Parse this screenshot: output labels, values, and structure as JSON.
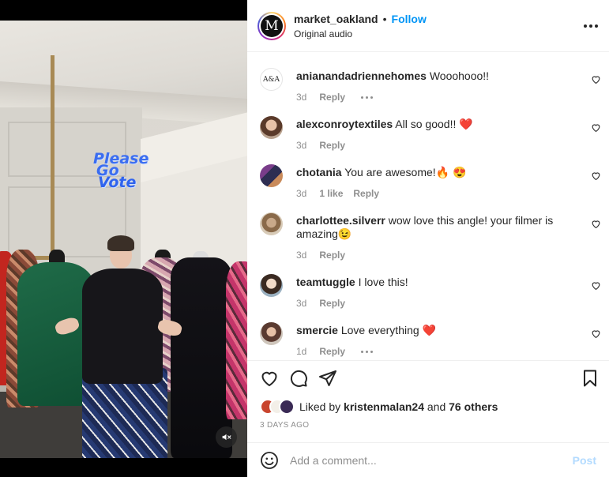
{
  "post": {
    "username": "market_oakland",
    "separator": "•",
    "follow_label": "Follow",
    "audio": "Original audio",
    "avatar_letter": "M",
    "more_icon": "more-horizontal-icon"
  },
  "media": {
    "sticker_lines": [
      "Please",
      "Go",
      "Vote"
    ],
    "mute_icon": "speaker-muted-icon"
  },
  "comments": [
    {
      "username": "anianandadriennehomes",
      "text": "Wooohooo!!",
      "time": "3d",
      "likes": "",
      "reply": "Reply",
      "has_more": true,
      "avatar_text": "A&A"
    },
    {
      "username": "alexconroytextiles",
      "text": "All so good!! ❤️",
      "time": "3d",
      "likes": "",
      "reply": "Reply",
      "has_more": false
    },
    {
      "username": "chotania",
      "text": "You are awesome!🔥 😍",
      "time": "3d",
      "likes": "1 like",
      "reply": "Reply",
      "has_more": false
    },
    {
      "username": "charlottee.silverr",
      "text": "wow love this angle! your filmer is amazing😉",
      "time": "3d",
      "likes": "",
      "reply": "Reply",
      "has_more": false
    },
    {
      "username": "teamtuggle",
      "text": "I love this!",
      "time": "3d",
      "likes": "",
      "reply": "Reply",
      "has_more": false
    },
    {
      "username": "smercie",
      "text": "Love everything ❤️",
      "time": "1d",
      "likes": "",
      "reply": "Reply",
      "has_more": true
    }
  ],
  "actions": {
    "liked_prefix": "Liked by",
    "liked_user": "kristenmalan24",
    "liked_and": "and",
    "liked_others": "76 others",
    "date": "3 DAYS AGO"
  },
  "composer": {
    "placeholder": "Add a comment...",
    "post_label": "Post"
  },
  "colors": {
    "link_blue": "#0095f6",
    "post_disabled": "#b3dbff",
    "secondary_text": "#8e8e8e",
    "sticker_blue": "#3b6df0"
  }
}
